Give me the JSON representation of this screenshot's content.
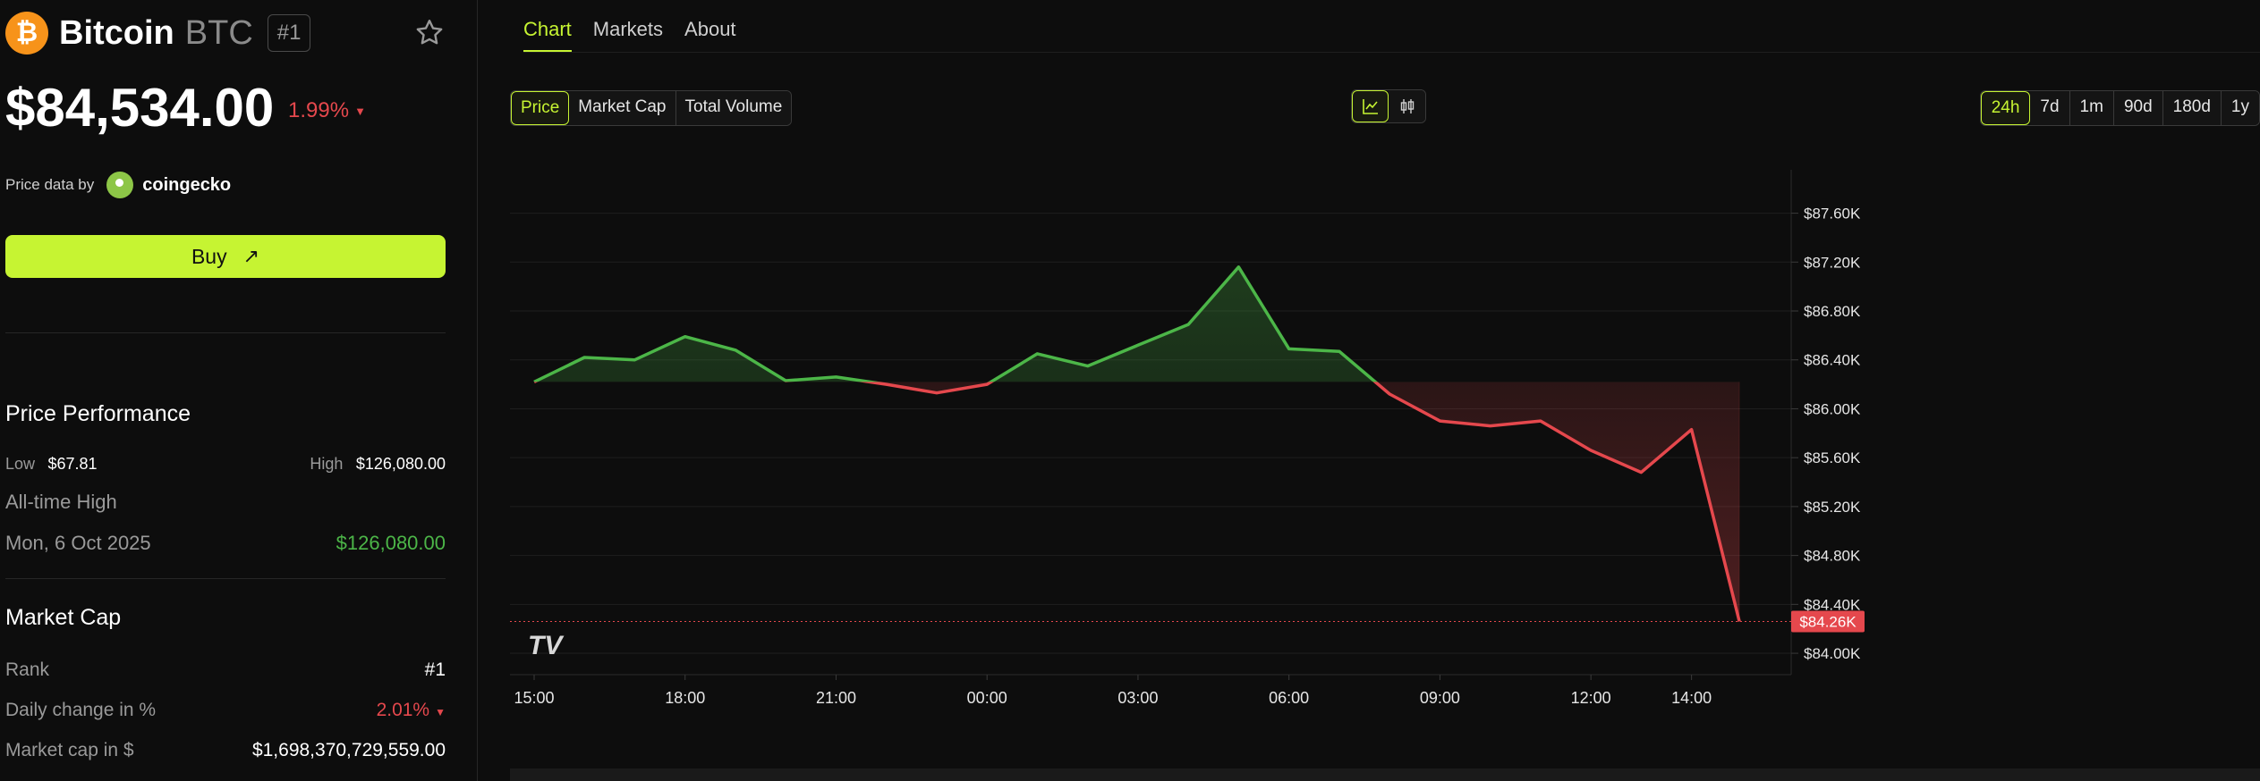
{
  "coin": {
    "logo_glyph": "₿",
    "name": "Bitcoin",
    "symbol": "BTC",
    "rank_chip": "#1",
    "price": "$84,534.00",
    "change": "1.99%",
    "change_direction_glyph": "▼",
    "price_source_label": "Price data by",
    "price_source_name": "coingecko"
  },
  "buy": {
    "label": "Buy",
    "arrow": "↗"
  },
  "performance": {
    "title": "Price Performance",
    "low_label": "Low",
    "low_value": "$67.81",
    "high_label": "High",
    "high_value": "$126,080.00",
    "ath_label": "All-time High",
    "ath_date": "Mon, 6 Oct 2025",
    "ath_value": "$126,080.00"
  },
  "market_cap": {
    "title": "Market Cap",
    "rank_label": "Rank",
    "rank_value": "#1",
    "daily_change_label": "Daily change in %",
    "daily_change_value": "2.01%",
    "daily_change_glyph": "▼",
    "cap_label": "Market cap in $",
    "cap_value": "$1,698,370,729,559.00"
  },
  "tabs": [
    {
      "label": "Chart",
      "active": true
    },
    {
      "label": "Markets",
      "active": false
    },
    {
      "label": "About",
      "active": false
    }
  ],
  "metrics": [
    {
      "label": "Price",
      "active": true
    },
    {
      "label": "Market Cap",
      "active": false
    },
    {
      "label": "Total Volume",
      "active": false
    }
  ],
  "views": [
    {
      "icon": "line-chart-icon",
      "active": true
    },
    {
      "icon": "candlestick-icon",
      "active": false
    }
  ],
  "ranges": [
    {
      "label": "24h",
      "active": true
    },
    {
      "label": "7d",
      "active": false
    },
    {
      "label": "1m",
      "active": false
    },
    {
      "label": "90d",
      "active": false
    },
    {
      "label": "180d",
      "active": false
    },
    {
      "label": "1y",
      "active": false
    }
  ],
  "colors": {
    "accent": "#c6f432",
    "up": "#4cb648",
    "down": "#e5484d",
    "background": "#0d0d0d"
  },
  "chart_data": {
    "type": "line",
    "baseline": 86220,
    "last_value_label": "$84.26K",
    "watermark": "TV",
    "x_ticks": [
      "15:00",
      "18:00",
      "21:00",
      "00:00",
      "03:00",
      "06:00",
      "09:00",
      "12:00",
      "14:00"
    ],
    "y_ticks": [
      "$84.00K",
      "$84.40K",
      "$84.80K",
      "$85.20K",
      "$85.60K",
      "$86.00K",
      "$86.40K",
      "$86.80K",
      "$87.20K",
      "$87.60K"
    ],
    "y_tick_values": [
      84000,
      84400,
      84800,
      85200,
      85600,
      86000,
      86400,
      86800,
      87200,
      87600
    ],
    "ylim": [
      83825,
      87955
    ],
    "xlim": [
      14.52,
      39.98
    ],
    "x": [
      15.0,
      16.0,
      17.0,
      18.0,
      19.0,
      20.0,
      21.0,
      22.0,
      23.0,
      24.0,
      25.0,
      26.0,
      27.0,
      28.0,
      29.0,
      30.0,
      31.0,
      32.0,
      33.0,
      34.0,
      35.0,
      36.0,
      37.0,
      38.0,
      38.95
    ],
    "values": [
      86220,
      86420,
      86400,
      86590,
      86480,
      86230,
      86260,
      86200,
      86130,
      86200,
      86450,
      86350,
      86520,
      86690,
      87160,
      86490,
      86470,
      86120,
      85900,
      85860,
      85900,
      85660,
      85480,
      85830,
      84260
    ],
    "grid": true
  }
}
